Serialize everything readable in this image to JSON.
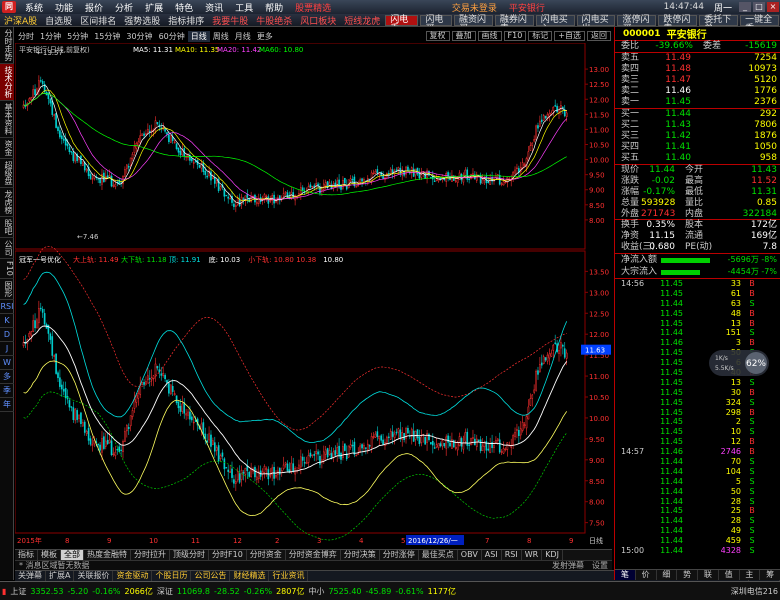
{
  "menubar": {
    "items": [
      "系统",
      "功能",
      "报价",
      "分析",
      "扩展",
      "特色",
      "资讯",
      "工具",
      "帮助"
    ],
    "promo": "股票精选",
    "login_status": "交易未登录",
    "broker": "平安银行",
    "time": "14:47:44",
    "right_btn": "周一"
  },
  "toolbar": {
    "left": [
      "沪深A股",
      "自选股",
      "区间排名",
      "强势选股",
      "指标排序"
    ],
    "promo1": "我要牛股",
    "promo2": "牛股绝杀",
    "promo3": "风口板块",
    "promo4": "短线龙虎",
    "right": [
      "闪电买",
      "融资闪买",
      "融券闪卖",
      "闪电买入",
      "闪电买出",
      "涨停闪买",
      "跌停闪卖",
      "委托下单",
      "一键全委"
    ],
    "hot": "闪电手"
  },
  "left_tabs": [
    "分时走势",
    "技术分析",
    "基本资料",
    "资金",
    "超级盘",
    "龙虎榜",
    "股吧",
    "公司",
    "F10",
    "图形"
  ],
  "left_tabs_extra": [
    "RSI",
    "K",
    "D",
    "J",
    "W",
    "多",
    "季",
    "年"
  ],
  "chart_header": {
    "tabs": [
      "分时",
      "1分钟",
      "5分钟",
      "15分钟",
      "30分钟",
      "60分钟",
      "日线",
      "周线",
      "月线",
      "更多"
    ],
    "selected": "日线",
    "right_tabs": [
      "复权",
      "叠加",
      "画线",
      "F10",
      "标记",
      "+自选",
      "返回"
    ]
  },
  "kline": {
    "legend_title": "平安银行(日线,前复权)",
    "ma_labels": [
      "MA5: 11.31",
      "MA10: 11.35",
      "MA20: 11.42",
      "MA60: 10.80"
    ],
    "ma_colors": [
      "#ffffff",
      "#ffff00",
      "#ff40ff",
      "#00ff00"
    ],
    "high_label": "13.57",
    "low_label": "7.46",
    "y_ticks": [
      "13.00",
      "12.50",
      "12.00",
      "11.50",
      "11.00",
      "10.50",
      "10.00",
      "9.50",
      "9.00",
      "8.50",
      "8.00"
    ]
  },
  "indicator": {
    "title": "冠军一号优化",
    "labels": [
      {
        "text": "大上轨: 11.49",
        "color": "#ff3030"
      },
      {
        "text": "大下轨: 11.18",
        "color": "#00e000"
      },
      {
        "text": "顶: 11.91",
        "color": "#00e0e0"
      },
      {
        "text": "底: 10.03",
        "color": "#ffffff"
      },
      {
        "text": "小下轨: 10.80",
        "color": "#ff3030"
      },
      {
        "text": "10.38",
        "color": "#ff3030"
      },
      {
        "text": "10.80",
        "color": "#ffffff"
      }
    ],
    "y_ticks": [
      "13.50",
      "13.00",
      "12.50",
      "12.00",
      "11.50",
      "11.00",
      "10.50",
      "10.00",
      "9.50",
      "9.00",
      "8.50",
      "8.00",
      "7.50"
    ],
    "current_price_tag": "11.63",
    "date_start": "2015年",
    "date_cursor": "2016/12/26/一",
    "months": [
      "8",
      "9",
      "10",
      "11",
      "12",
      "2",
      "3",
      "4",
      "5",
      "6",
      "7",
      "8",
      "9"
    ],
    "right_label": "日线"
  },
  "ind_tabs": [
    "指标",
    "模板",
    "全部",
    "热度金融特",
    "分时拉升",
    "顶级分时",
    "分时F10",
    "分时资金",
    "分时资金博弈",
    "分时决策",
    "分时涨停",
    "最佳买点",
    "OBV",
    "ASI",
    "RSI",
    "WR",
    "KDJ"
  ],
  "page_tabs": {
    "left": "* 消息区域暂无数据",
    "right": "发射弹幕",
    "settings": "设置"
  },
  "news_bar": {
    "items": [
      "关弹幕",
      "扩展A",
      "关联报价",
      "资金驱动",
      "个股日历",
      "公司公告",
      "财经精选",
      "行业资讯"
    ],
    "right": [
      "图文F10",
      "新信息"
    ]
  },
  "stock": {
    "code": "000001",
    "name": "平安银行",
    "weibi_label": "委比",
    "weibi": "-39.66%",
    "weicha_label": "委差",
    "weicha": "-15619"
  },
  "asks": [
    {
      "label": "卖五",
      "price": "11.49",
      "vol": "7254",
      "pc": "red"
    },
    {
      "label": "卖四",
      "price": "11.48",
      "vol": "10973",
      "pc": "red"
    },
    {
      "label": "卖三",
      "price": "11.47",
      "vol": "5120",
      "pc": "red"
    },
    {
      "label": "卖二",
      "price": "11.46",
      "vol": "1776",
      "pc": "white"
    },
    {
      "label": "卖一",
      "price": "11.45",
      "vol": "2376",
      "pc": "green"
    }
  ],
  "bids": [
    {
      "label": "买一",
      "price": "11.44",
      "vol": "292",
      "pc": "green"
    },
    {
      "label": "买二",
      "price": "11.43",
      "vol": "7806",
      "pc": "green"
    },
    {
      "label": "买三",
      "price": "11.42",
      "vol": "1876",
      "pc": "green"
    },
    {
      "label": "买四",
      "price": "11.41",
      "vol": "1050",
      "pc": "green"
    },
    {
      "label": "买五",
      "price": "11.40",
      "vol": "958",
      "pc": "green"
    }
  ],
  "quote": [
    {
      "l1": "现价",
      "v1": "11.44",
      "c1": "green",
      "l2": "今开",
      "v2": "11.43",
      "c2": "green"
    },
    {
      "l1": "涨跌",
      "v1": "-0.02",
      "c1": "green",
      "l2": "最高",
      "v2": "11.52",
      "c2": "red"
    },
    {
      "l1": "涨幅",
      "v1": "-0.17%",
      "c1": "green",
      "l2": "最低",
      "v2": "11.31",
      "c2": "green"
    },
    {
      "l1": "总量",
      "v1": "593928",
      "c1": "yellow",
      "l2": "量比",
      "v2": "0.85",
      "c2": "yellow"
    },
    {
      "l1": "外盘",
      "v1": "271743",
      "c1": "red",
      "l2": "内盘",
      "v2": "322184",
      "c2": "green"
    },
    {
      "l1": "换手",
      "v1": "0.35%",
      "c1": "white",
      "l2": "股本",
      "v2": "172亿",
      "c2": "white"
    },
    {
      "l1": "净资",
      "v1": "11.15",
      "c1": "white",
      "l2": "流通",
      "v2": "169亿",
      "c2": "white"
    },
    {
      "l1": "收益(三)",
      "v1": "0.680",
      "c1": "white",
      "l2": "PE(动)",
      "v2": "7.8",
      "c2": "white"
    }
  ],
  "flows": [
    {
      "label": "净流入额",
      "value": "-5696万 -8%",
      "bar": 0.7
    },
    {
      "label": "大宗流入",
      "value": "-4454万 -7%",
      "bar": 0.55
    }
  ],
  "ticks": [
    {
      "t": "14:56",
      "p": "11.45",
      "v": "33",
      "d": "B",
      "dc": "red"
    },
    {
      "t": "",
      "p": "11.45",
      "v": "61",
      "d": "B",
      "dc": "red"
    },
    {
      "t": "",
      "p": "11.44",
      "v": "63",
      "d": "S",
      "dc": "green"
    },
    {
      "t": "",
      "p": "11.45",
      "v": "48",
      "d": "B",
      "dc": "red"
    },
    {
      "t": "",
      "p": "11.45",
      "v": "13",
      "d": "B",
      "dc": "red"
    },
    {
      "t": "",
      "p": "11.44",
      "v": "151",
      "d": "S",
      "dc": "green"
    },
    {
      "t": "",
      "p": "11.46",
      "v": "3",
      "d": "B",
      "dc": "red"
    },
    {
      "t": "",
      "p": "11.45",
      "v": "50",
      "d": "S",
      "dc": "green"
    },
    {
      "t": "",
      "p": "11.45",
      "v": "6",
      "d": "B",
      "dc": "red"
    },
    {
      "t": "",
      "p": "11.45",
      "v": "40",
      "d": "B",
      "dc": "red"
    },
    {
      "t": "",
      "p": "11.45",
      "v": "13",
      "d": "S",
      "dc": "green"
    },
    {
      "t": "",
      "p": "11.45",
      "v": "30",
      "d": "B",
      "dc": "red"
    },
    {
      "t": "",
      "p": "11.45",
      "v": "324",
      "d": "S",
      "dc": "green"
    },
    {
      "t": "",
      "p": "11.45",
      "v": "298",
      "d": "B",
      "dc": "red"
    },
    {
      "t": "",
      "p": "11.45",
      "v": "2",
      "d": "S",
      "dc": "green"
    },
    {
      "t": "",
      "p": "11.45",
      "v": "10",
      "d": "S",
      "dc": "green"
    },
    {
      "t": "",
      "p": "11.45",
      "v": "12",
      "d": "B",
      "dc": "red"
    },
    {
      "t": "14:57",
      "p": "11.46",
      "v": "2746",
      "d": "B",
      "dc": "red"
    },
    {
      "t": "",
      "p": "11.44",
      "v": "70",
      "d": "S",
      "dc": "green"
    },
    {
      "t": "",
      "p": "11.44",
      "v": "104",
      "d": "S",
      "dc": "green"
    },
    {
      "t": "",
      "p": "11.44",
      "v": "5",
      "d": "S",
      "dc": "green"
    },
    {
      "t": "",
      "p": "11.44",
      "v": "50",
      "d": "S",
      "dc": "green"
    },
    {
      "t": "",
      "p": "11.44",
      "v": "28",
      "d": "S",
      "dc": "green"
    },
    {
      "t": "",
      "p": "11.45",
      "v": "25",
      "d": "B",
      "dc": "red"
    },
    {
      "t": "",
      "p": "11.44",
      "v": "28",
      "d": "S",
      "dc": "green"
    },
    {
      "t": "",
      "p": "11.44",
      "v": "49",
      "d": "S",
      "dc": "green"
    },
    {
      "t": "",
      "p": "11.44",
      "v": "459",
      "d": "S",
      "dc": "green"
    },
    {
      "t": "15:00",
      "p": "11.44",
      "v": "4328",
      "d": "S",
      "dc": "green"
    }
  ],
  "rp_tabs": [
    "笔",
    "价",
    "细",
    "势",
    "联",
    "值",
    "主",
    "筹"
  ],
  "net_badge": {
    "up": "1K/s",
    "down": "5.5K/s",
    "pct": "62%"
  },
  "status": {
    "sh_label": "上证",
    "sh": "3352.53",
    "sh_chg": "-5.20",
    "sh_pct": "-0.16%",
    "sh_amt": "2066亿",
    "sz_label": "深证",
    "sz": "11069.8",
    "sz_chg": "-28.52",
    "sz_pct": "-0.26%",
    "sz_amt": "2807亿",
    "zx_label": "中小",
    "zx": "7525.40",
    "zx_chg": "-45.89",
    "zx_pct": "-0.61%",
    "zx_amt": "1177亿",
    "server": "深圳电信216"
  }
}
